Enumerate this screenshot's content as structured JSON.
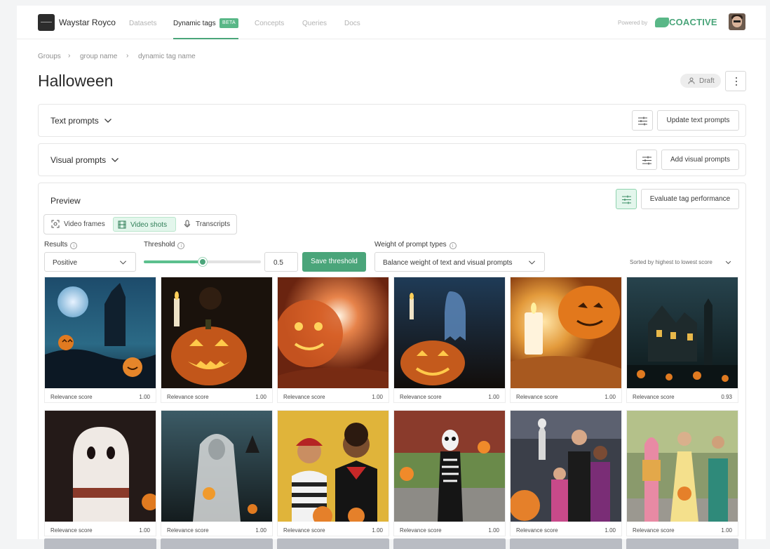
{
  "header": {
    "org_name": "Waystar Royco",
    "nav": [
      {
        "label": "Datasets",
        "active": false
      },
      {
        "label": "Dynamic tags",
        "active": true,
        "badge": "BETA"
      },
      {
        "label": "Concepts",
        "active": false
      },
      {
        "label": "Queries",
        "active": false
      },
      {
        "label": "Docs",
        "active": false
      }
    ],
    "powered_by": "Powered by",
    "brand": "COACTIVE",
    "accent_color": "#4aa57a"
  },
  "breadcrumb": [
    "Groups",
    "group name",
    "dynamic tag name"
  ],
  "page": {
    "title": "Halloween",
    "status": "Draft"
  },
  "text_prompts": {
    "title": "Text prompts",
    "action": "Update text prompts"
  },
  "visual_prompts": {
    "title": "Visual prompts",
    "action": "Add visual prompts"
  },
  "preview": {
    "title": "Preview",
    "action": "Evaluate tag performance",
    "tabs": [
      {
        "label": "Video frames",
        "icon": "frame-icon",
        "active": false
      },
      {
        "label": "Video shots",
        "icon": "film-icon",
        "active": true
      },
      {
        "label": "Transcripts",
        "icon": "mic-icon",
        "active": false
      }
    ],
    "results_label": "Results",
    "results_value": "Positive",
    "threshold_label": "Threshold",
    "threshold_value": "0.5",
    "threshold_fraction": 0.5,
    "save_threshold": "Save threshold",
    "weight_label": "Weight of prompt types",
    "weight_value": "Balance weight of text and visual prompts",
    "sort_label": "Sorted by highest to lowest score",
    "cards": [
      {
        "caption": "Relevance score",
        "score": "1.00",
        "image": "haunted-moon-pumpkins"
      },
      {
        "caption": "Relevance score",
        "score": "1.00",
        "image": "carved-pumpkin-candle"
      },
      {
        "caption": "Relevance score",
        "score": "1.00",
        "image": "glowing-pumpkin-burst"
      },
      {
        "caption": "Relevance score",
        "score": "1.00",
        "image": "ghost-and-pumpkin"
      },
      {
        "caption": "Relevance score",
        "score": "1.00",
        "image": "pumpkin-with-candles"
      },
      {
        "caption": "Relevance score",
        "score": "0.93",
        "image": "haunted-house-night"
      },
      {
        "caption": "Relevance score",
        "score": "1.00",
        "image": "ghost-costume"
      },
      {
        "caption": "Relevance score",
        "score": "1.00",
        "image": "veiled-bride-costume"
      },
      {
        "caption": "Relevance score",
        "score": "1.00",
        "image": "kids-pirate-vampire"
      },
      {
        "caption": "Relevance score",
        "score": "1.00",
        "image": "skeleton-costume"
      },
      {
        "caption": "Relevance score",
        "score": "1.00",
        "image": "family-costumes"
      },
      {
        "caption": "Relevance score",
        "score": "1.00",
        "image": "kids-trick-or-treat"
      }
    ]
  }
}
